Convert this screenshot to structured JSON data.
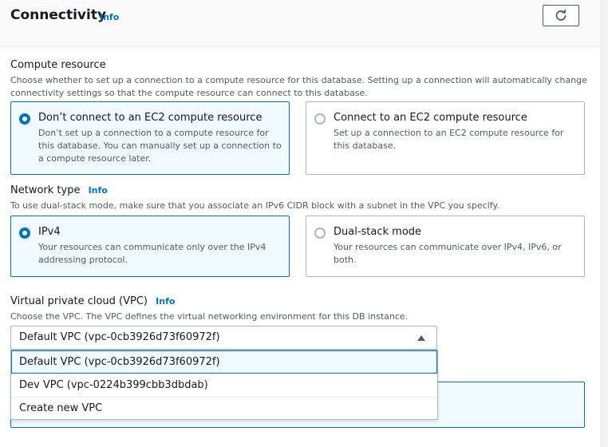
{
  "header": {
    "title": "Connectivity",
    "info": "Info",
    "refresh_icon": "refresh-icon"
  },
  "compute": {
    "label": "Compute resource",
    "description_line1": "Choose whether to set up a connection to a compute resource for this database. Setting up a connection will automatically change",
    "description_line2": "connectivity settings so that the compute resource can connect to this database.",
    "options": [
      {
        "title": "Don’t connect to an EC2 compute resource",
        "desc": [
          "Don’t set up a connection to a compute resource for",
          "this database. You can manually set up a connection to",
          "a compute resource later."
        ],
        "selected": true
      },
      {
        "title": "Connect to an EC2 compute resource",
        "desc": [
          "Set up a connection to an EC2 compute resource for",
          "this database."
        ],
        "selected": false
      }
    ]
  },
  "network": {
    "label": "Network type",
    "info": "Info",
    "description": "To use dual-stack mode, make sure that you associate an IPv6 CIDR block with a subnet in the VPC you specify.",
    "options": [
      {
        "title": "IPv4",
        "desc": [
          "Your resources can communicate only over the IPv4",
          "addressing protocol."
        ],
        "selected": true
      },
      {
        "title": "Dual-stack mode",
        "desc": [
          "Your resources can communicate over IPv4, IPv6, or",
          "both."
        ],
        "selected": false
      }
    ]
  },
  "vpc": {
    "label": "Virtual private cloud (VPC)",
    "info": "Info",
    "description": "Choose the VPC. The VPC defines the virtual networking environment for this DB instance.",
    "selected": "Default VPC (vpc-0cb3926d73f60972f)",
    "options": [
      "Default VPC (vpc-0cb3926d73f60972f)",
      "Dev VPC (vpc-0224b399cbb3dbdab)",
      "Create new VPC"
    ],
    "expanded": true
  },
  "colors": {
    "accent": "#0073bb",
    "selected_bg": "#f1faff",
    "border": "#aab7b8",
    "text": "#16191f",
    "muted": "#545b64"
  }
}
